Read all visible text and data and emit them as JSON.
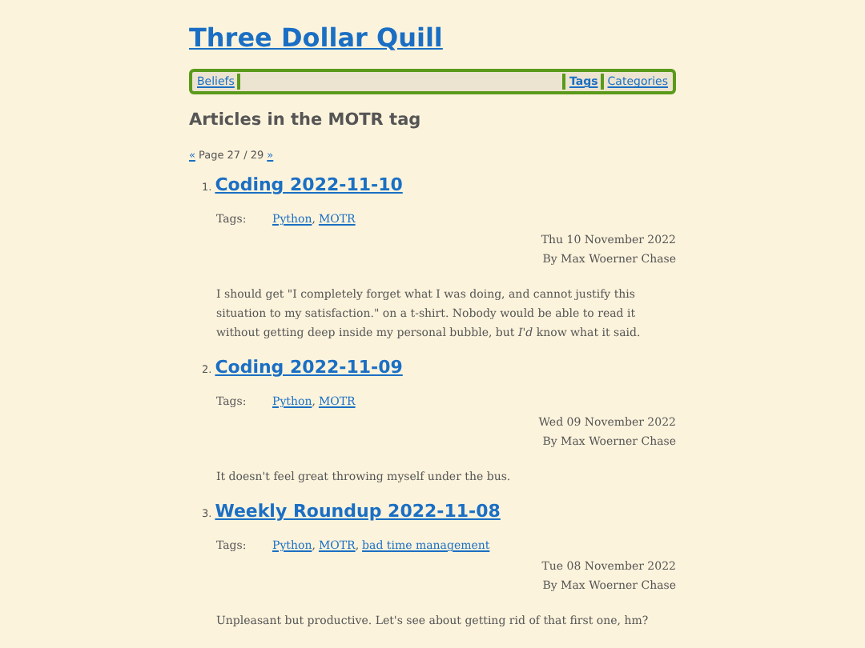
{
  "site_title": "Three Dollar Quill",
  "nav": [
    {
      "label": "Beliefs",
      "selected": false
    },
    {
      "label": "Tags",
      "selected": true
    },
    {
      "label": "Categories",
      "selected": false
    }
  ],
  "heading": "Articles in the MOTR tag",
  "pager": {
    "prev": "«",
    "label": "Page 27 / 29",
    "next": "»"
  },
  "articles": [
    {
      "number": "1.",
      "title": "Coding 2022-11-10",
      "tags_label": "Tags:",
      "tags": [
        {
          "name": "Python",
          "separator": ","
        },
        {
          "name": "MOTR"
        }
      ],
      "date": "Thu 10 November 2022",
      "author": "By Max Woerner Chase",
      "summary": "I should get \"I completely forget what I was doing, and cannot justify this situation to my satisfaction.\" on a t-shirt. Nobody would be able to read it without getting deep inside my personal bubble, but *I'd* know what it said."
    },
    {
      "number": "2.",
      "title": "Coding 2022-11-09",
      "tags_label": "Tags:",
      "tags": [
        {
          "name": "Python",
          "separator": ","
        },
        {
          "name": "MOTR"
        }
      ],
      "date": "Wed 09 November 2022",
      "author": "By Max Woerner Chase",
      "summary": "It doesn't feel great throwing myself under the bus."
    },
    {
      "number": "3.",
      "title": "Weekly Roundup 2022-11-08",
      "tags_label": "Tags:",
      "tags": [
        {
          "name": "Python",
          "separator": ","
        },
        {
          "name": "MOTR",
          "separator": ","
        },
        {
          "name": "bad time management"
        }
      ],
      "date": "Tue 08 November 2022",
      "author": "By Max Woerner Chase",
      "summary": "Unpleasant but productive. Let's see about getting rid of that first one, hm?"
    }
  ]
}
